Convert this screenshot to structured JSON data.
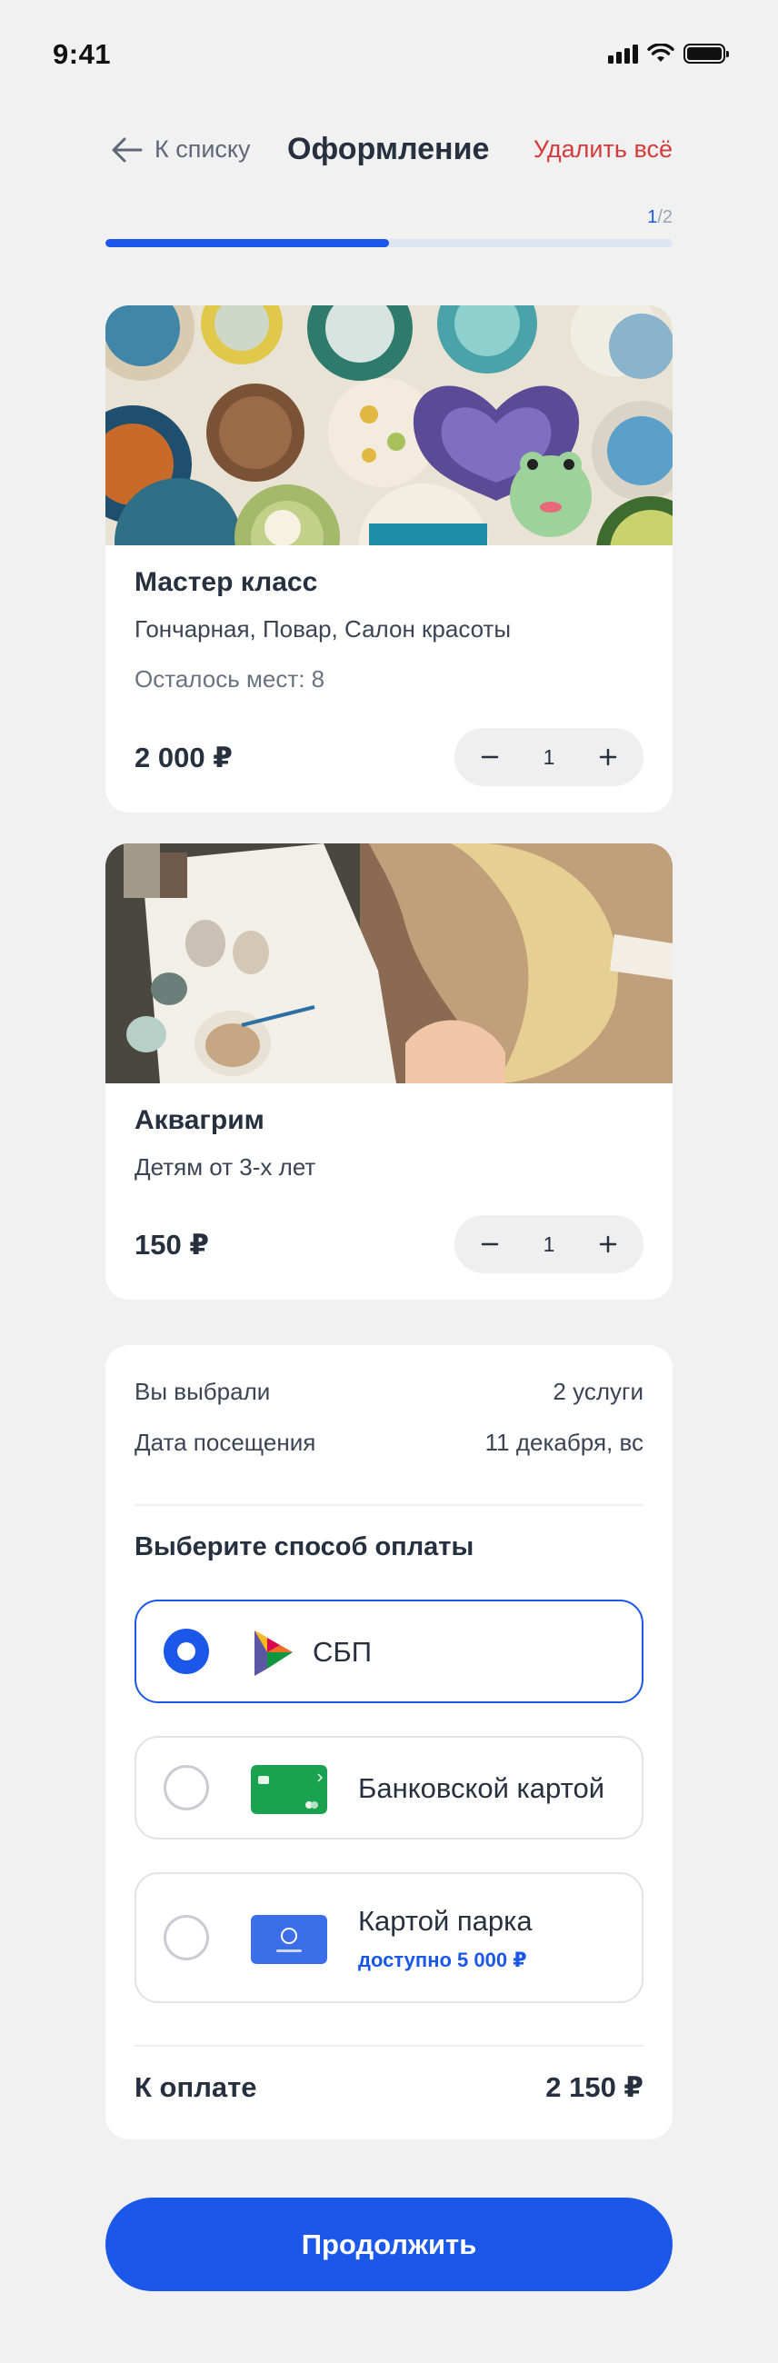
{
  "status_bar": {
    "time": "9:41"
  },
  "header": {
    "back_label": "К списку",
    "title": "Оформление",
    "delete_all": "Удалить всё"
  },
  "progress": {
    "current": "1",
    "separator": "/",
    "total": "2",
    "fraction": 0.5
  },
  "items": [
    {
      "title": "Мастер класс",
      "subtitle": "Гончарная, Повар, Салон красоты",
      "seats": "Осталось мест: 8",
      "price": "2 000 ₽",
      "quantity": "1"
    },
    {
      "title": "Аквагрим",
      "subtitle": "Детям от 3-х лет",
      "price": "150 ₽",
      "quantity": "1"
    }
  ],
  "summary": {
    "chosen_label": "Вы выбрали",
    "chosen_value": "2 услуги",
    "date_label": "Дата посещения",
    "date_value": "11 декабря, вс",
    "payment_title": "Выберите способ оплаты",
    "payment_options": [
      {
        "label": "СБП",
        "selected": true,
        "icon": "sbp-logo-icon"
      },
      {
        "label": "Банковской картой",
        "selected": false,
        "icon": "bank-card-icon"
      },
      {
        "label": "Картой парка",
        "sub": "доступно 5 000 ₽",
        "selected": false,
        "icon": "park-card-icon"
      }
    ],
    "total_label": "К оплате",
    "total_value": "2 150 ₽"
  },
  "continue_label": "Продолжить",
  "colors": {
    "accent": "#1b57e8",
    "danger": "#d63b3b",
    "background": "#f1f1f2"
  }
}
